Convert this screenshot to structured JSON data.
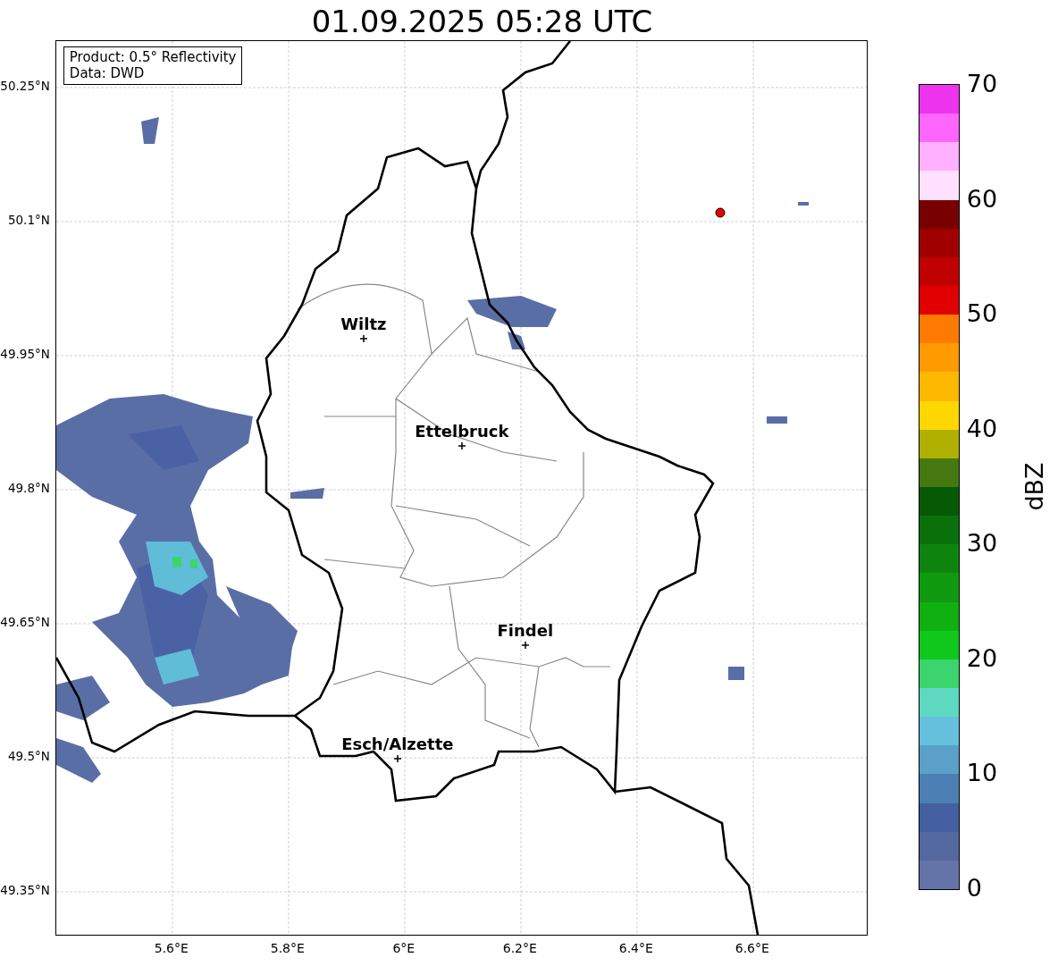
{
  "title": "01.09.2025 05:28 UTC",
  "legend": [
    "Product: 0.5° Reflectivity",
    "Data: DWD"
  ],
  "map": {
    "cities": [
      "Wiltz",
      "Ettelbruck",
      "Findel",
      "Esch/Alzette"
    ],
    "xticks": [
      "5.6°E",
      "5.8°E",
      "6°E",
      "6.2°E",
      "6.4°E",
      "6.6°E"
    ],
    "yticks": [
      "50.25°N",
      "50.1°N",
      "49.95°N",
      "49.8°N",
      "49.65°N",
      "49.5°N",
      "49.35°N"
    ]
  },
  "colorbar": {
    "label": "dBZ",
    "ticks": [
      "70",
      "60",
      "50",
      "40",
      "30",
      "20",
      "10",
      "0"
    ],
    "segments": [
      {
        "color": "#ee33ee"
      },
      {
        "color": "#ff66ff"
      },
      {
        "color": "#ffb0ff"
      },
      {
        "color": "#ffe0ff"
      },
      {
        "color": "#780000"
      },
      {
        "color": "#a00000"
      },
      {
        "color": "#c00000"
      },
      {
        "color": "#e00000"
      },
      {
        "color": "#ff7a00"
      },
      {
        "color": "#ff9a00"
      },
      {
        "color": "#ffb800"
      },
      {
        "color": "#ffd700"
      },
      {
        "color": "#b0b000"
      },
      {
        "color": "#467810"
      },
      {
        "color": "#065a06"
      },
      {
        "color": "#0a700a"
      },
      {
        "color": "#0e840e"
      },
      {
        "color": "#109a10"
      },
      {
        "color": "#10b010"
      },
      {
        "color": "#10c81c"
      },
      {
        "color": "#3cd46c"
      },
      {
        "color": "#5ed8c0"
      },
      {
        "color": "#64c0dc"
      },
      {
        "color": "#5aa0c8"
      },
      {
        "color": "#4c80b4"
      },
      {
        "color": "#4460a0"
      },
      {
        "color": "#5468a0"
      },
      {
        "color": "#6474a8"
      }
    ]
  }
}
